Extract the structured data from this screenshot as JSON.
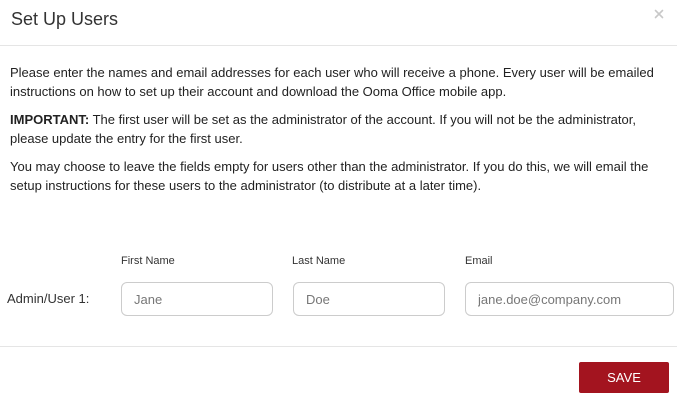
{
  "modal": {
    "title": "Set Up Users",
    "close_icon": "close-icon"
  },
  "intro": {
    "paragraph1": "Please enter the names and email addresses for each user who will receive a phone. Every user will be emailed instructions on how to set up their account and download the Ooma Office mobile app.",
    "important_label": "IMPORTANT:",
    "important_text": " The first user will be set as the administrator of the account. If you will not be the administrator, please update the entry for the first user.",
    "paragraph3": "You may choose to leave the fields empty for users other than the administrator. If you do this, we will email the setup instructions for these users to the administrator (to distribute at a later time)."
  },
  "form": {
    "columns": {
      "first_name": "First Name",
      "last_name": "Last Name",
      "email": "Email"
    },
    "rows": [
      {
        "label": "Admin/User 1:",
        "first_name_placeholder": "Jane",
        "last_name_placeholder": "Doe",
        "email_placeholder": "jane.doe@company.com"
      }
    ]
  },
  "footer": {
    "save_label": "SAVE",
    "save_color": "#a3141f"
  }
}
